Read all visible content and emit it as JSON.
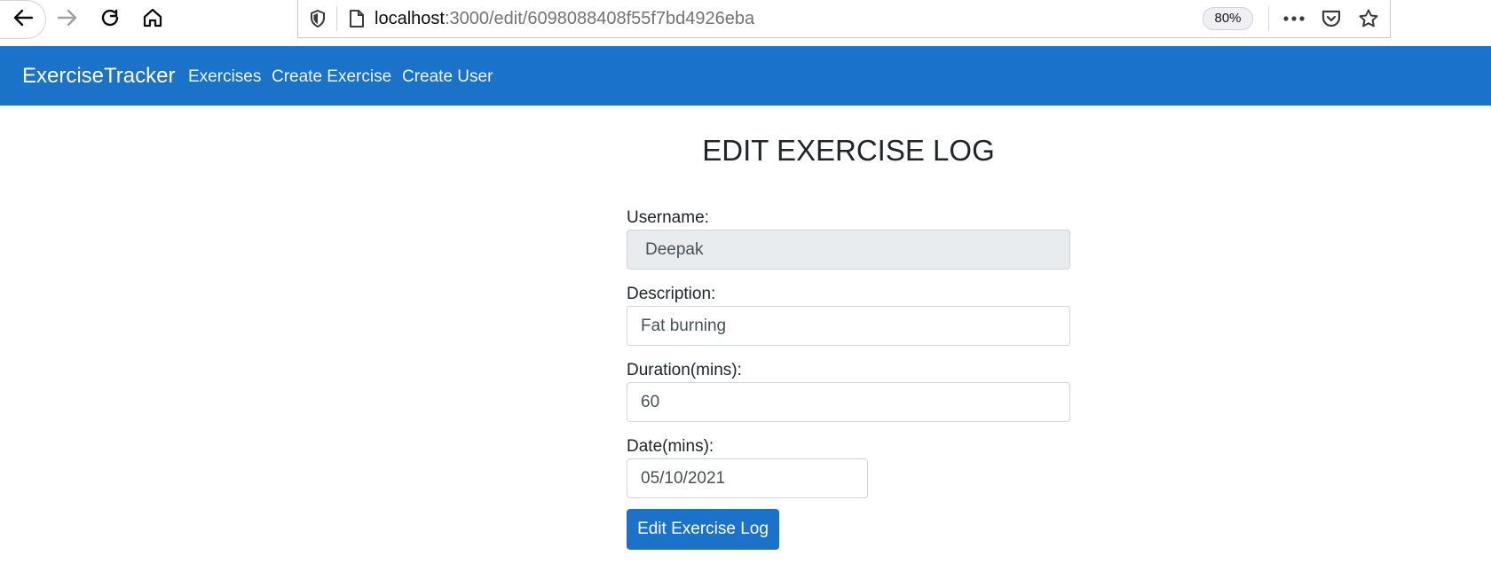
{
  "browser": {
    "url_host": "localhost",
    "url_path": ":3000/edit/6098088408f55f7bd4926eba",
    "zoom": "80%",
    "icons": {
      "back": "arrow-left-icon",
      "forward": "arrow-right-icon",
      "reload": "reload-icon",
      "home": "home-icon",
      "tracking": "shield-icon",
      "page": "page-icon",
      "more": "ellipsis-icon",
      "pocket": "pocket-icon",
      "bookmark": "star-icon"
    }
  },
  "navbar": {
    "brand": "ExerciseTracker",
    "links": [
      "Exercises",
      "Create Exercise",
      "Create User"
    ],
    "color": "#1a73c9"
  },
  "form": {
    "title": "EDIT EXERCISE LOG",
    "username_label": "Username:",
    "username_value": "Deepak",
    "description_label": "Description:",
    "description_value": "Fat burning",
    "duration_label": "Duration(mins):",
    "duration_value": "60",
    "date_label": "Date(mins):",
    "date_value": "05/10/2021",
    "submit_label": "Edit Exercise Log"
  }
}
